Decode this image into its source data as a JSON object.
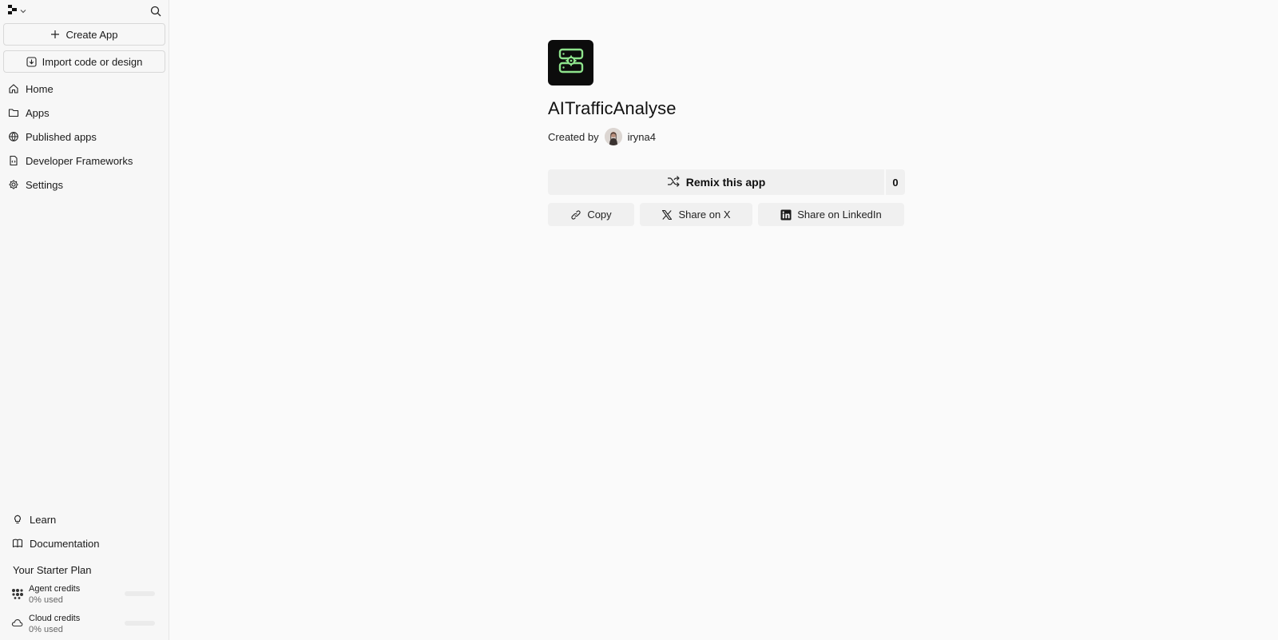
{
  "sidebar": {
    "brand_icon": "replit-logo-icon",
    "create_label": "Create App",
    "import_label": "Import code or design",
    "nav": [
      {
        "label": "Home",
        "icon": "home-icon"
      },
      {
        "label": "Apps",
        "icon": "folder-icon"
      },
      {
        "label": "Published apps",
        "icon": "globe-icon"
      },
      {
        "label": "Developer Frameworks",
        "icon": "file-code-icon"
      },
      {
        "label": "Settings",
        "icon": "gear-icon"
      }
    ],
    "bottom_nav": [
      {
        "label": "Learn",
        "icon": "lightbulb-icon"
      },
      {
        "label": "Documentation",
        "icon": "book-icon"
      }
    ],
    "plan_title": "Your Starter Plan",
    "credits": [
      {
        "name": "Agent credits",
        "usage": "0% used",
        "used_fraction": 0
      },
      {
        "name": "Cloud credits",
        "usage": "0% used",
        "used_fraction": 0
      }
    ]
  },
  "app": {
    "title": "AITrafficAnalyse",
    "created_by_label": "Created by",
    "creator": "iryna4",
    "remix_label": "Remix this app",
    "remix_count": "0",
    "copy_label": "Copy",
    "share_x_label": "Share on X",
    "share_linkedin_label": "Share on LinkedIn",
    "accent_color": "#8ee38c"
  }
}
